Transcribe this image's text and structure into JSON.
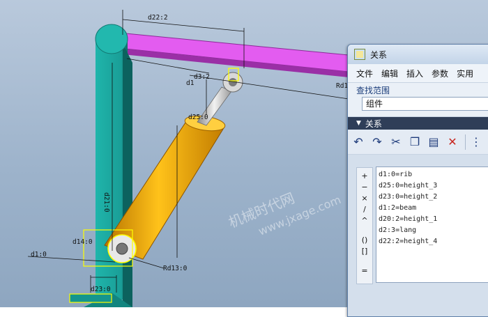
{
  "model": {
    "dimensions": {
      "d22": "d22:2",
      "d3": "d3:2",
      "d1_top": "d1",
      "rd_right": "Rd1",
      "d25": "d25:0",
      "d21": "d21:0",
      "d14": "d14:0",
      "d1_left": "d1:0",
      "rd13": "Rd13:0",
      "d23": "d23:0"
    },
    "colors": {
      "arm": "#1fa8a0",
      "beam": "#e060ee",
      "cylinder": "#f0a000",
      "rod": "#c8c8c8",
      "highlight": "#ffff00"
    }
  },
  "watermark": {
    "cn": "机械时代网",
    "url": "www.jxage.com"
  },
  "dialog": {
    "title": "关系",
    "menu": [
      "文件",
      "编辑",
      "插入",
      "参数",
      "实用"
    ],
    "scope_label": "查找范围",
    "scope_value": "组件",
    "section_label": "关系",
    "toolbar_icons": [
      "undo-icon",
      "redo-icon",
      "cut-icon",
      "copy-icon",
      "paste-icon",
      "delete-icon",
      "more-icon"
    ],
    "operators": [
      "+",
      "−",
      "×",
      "/",
      "^",
      "()",
      "[]",
      "="
    ],
    "relations": [
      "d1:0=rib",
      "d25:0=height_3",
      "d23:0=height_2",
      "d1:2=beam",
      "d20:2=height_1",
      "d2:3=lang",
      "d22:2=height_4"
    ]
  }
}
